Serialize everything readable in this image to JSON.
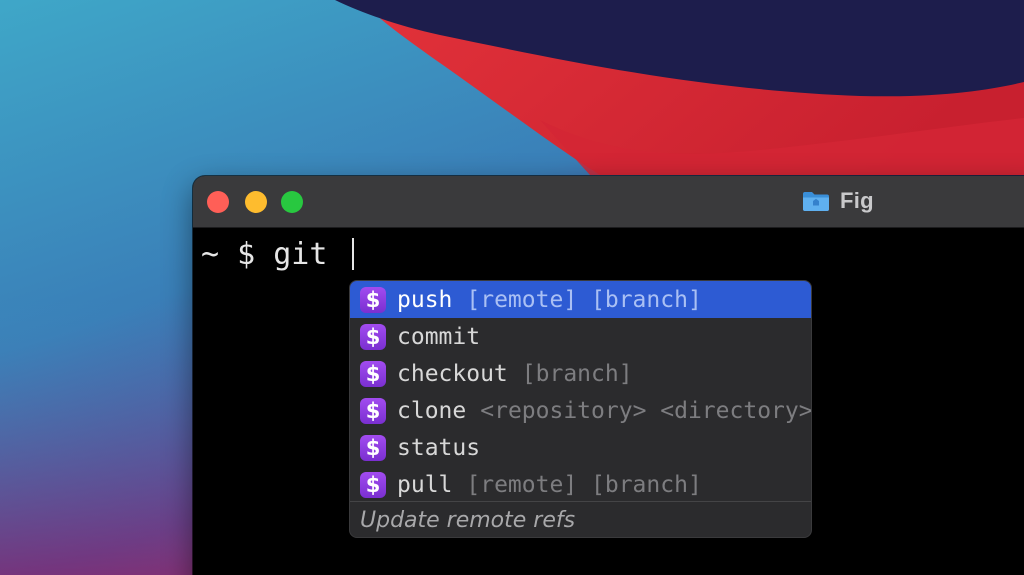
{
  "wallpaper": {
    "name": "macOS Big Sur wallpaper",
    "colors": {
      "navy": "#1e1f4f",
      "red": "#d12a38",
      "teal": "#3a9cc1",
      "purple": "#5a3c8e"
    }
  },
  "window": {
    "title": "Fig",
    "title_icon": "folder-icon",
    "traffic_lights": [
      "close",
      "minimize",
      "zoom"
    ],
    "colors": {
      "titlebar": "#3a3a3c",
      "background": "#000000",
      "close": "#ff5f57",
      "minimize": "#febc2e",
      "zoom": "#28c840"
    }
  },
  "terminal": {
    "prompt": "~ $ git "
  },
  "autocomplete": {
    "icon_glyph": "$",
    "icon_name": "dollar-sign-icon",
    "selected_color": "#2d5bd3",
    "icon_color": "#8e3fe0",
    "suggestions": [
      {
        "name": "push",
        "args": "[remote] [branch]",
        "selected": true
      },
      {
        "name": "commit",
        "args": "",
        "selected": false
      },
      {
        "name": "checkout",
        "args": "[branch]",
        "selected": false
      },
      {
        "name": "clone",
        "args": "<repository> <directory>",
        "selected": false
      },
      {
        "name": "status",
        "args": "",
        "selected": false
      },
      {
        "name": "pull",
        "args": "[remote] [branch]",
        "selected": false
      }
    ],
    "description": "Update remote refs"
  }
}
